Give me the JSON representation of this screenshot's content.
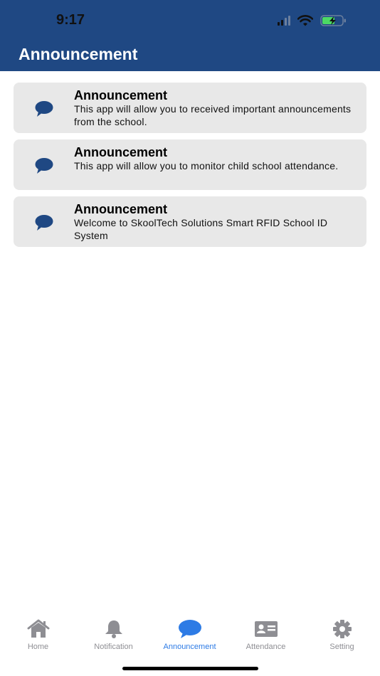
{
  "status_bar": {
    "time": "9:17"
  },
  "header": {
    "title": "Announcement",
    "bg_color": "#1f4883"
  },
  "announcements": [
    {
      "icon": "speech-bubble-icon",
      "title": "Announcement",
      "body": "This app will allow you to received important announcements from the school."
    },
    {
      "icon": "speech-bubble-icon",
      "title": "Announcement",
      "body": "This app will allow you to monitor child school attendance."
    },
    {
      "icon": "speech-bubble-icon",
      "title": "Announcement",
      "body": "Welcome to SkoolTech Solutions Smart RFID School ID System"
    }
  ],
  "tabbar": {
    "active": "Announcement",
    "active_color": "#2d7be5",
    "inactive_color": "#8e8e93",
    "tabs": [
      {
        "label": "Home",
        "icon": "home-icon"
      },
      {
        "label": "Notification",
        "icon": "bell-icon"
      },
      {
        "label": "Announcement",
        "icon": "speech-bubble-icon"
      },
      {
        "label": "Attendance",
        "icon": "id-card-icon"
      },
      {
        "label": "Setting",
        "icon": "gear-icon"
      }
    ]
  }
}
